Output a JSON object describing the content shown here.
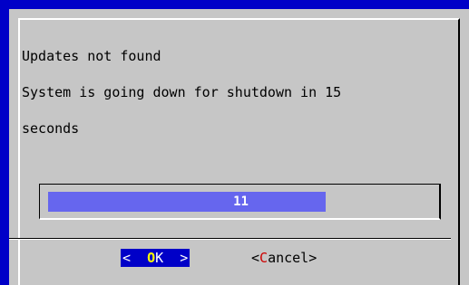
{
  "colors": {
    "screen_bg": "#0000c8",
    "dialog_bg": "#c6c6c6",
    "gauge_fill": "#6666ee",
    "button_active_bg": "#0000c8",
    "hotkey_active": "#ffff00",
    "hotkey_inactive": "#cc0000"
  },
  "message": {
    "line1": "Updates not found",
    "line2": "System is going down for shutdown in 15",
    "line3": "seconds"
  },
  "gauge": {
    "label": "11",
    "progress_fraction": 0.72
  },
  "buttons": {
    "ok": {
      "left": "<",
      "hotkey": "O",
      "rest": "K",
      "right": ">"
    },
    "cancel": {
      "left": "<",
      "hotkey": "C",
      "rest": "ancel",
      "right": ">"
    }
  }
}
